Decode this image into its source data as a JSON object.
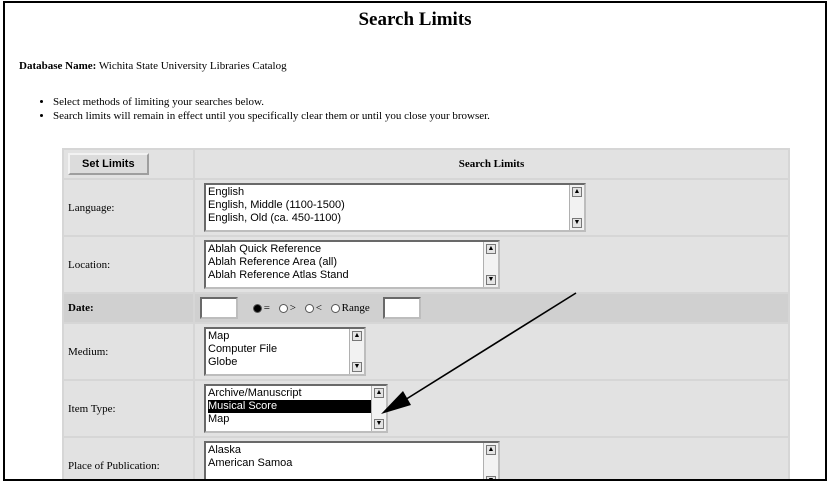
{
  "page": {
    "title": "Search Limits",
    "database_label": "Database Name:",
    "database_name": "Wichita State University Libraries Catalog",
    "bullets": [
      "Select methods of limiting your searches below.",
      "Search limits will remain in effect until you specifically clear them or until you close your browser."
    ]
  },
  "limits_table": {
    "set_limits_button": "Set Limits",
    "header": "Search Limits",
    "rows": {
      "language": {
        "label": "Language:",
        "options": [
          "English",
          "English, Middle (1100-1500)",
          "English, Old (ca. 450-1100)"
        ]
      },
      "location": {
        "label": "Location:",
        "options": [
          "Ablah Quick Reference",
          "Ablah Reference Area (all)",
          "Ablah Reference Atlas Stand"
        ]
      },
      "date": {
        "label": "Date:",
        "radios": [
          "=",
          ">",
          "<",
          "Range"
        ],
        "selected_radio": "="
      },
      "medium": {
        "label": "Medium:",
        "options": [
          "Map",
          "Computer File",
          "Globe"
        ]
      },
      "item_type": {
        "label": "Item Type:",
        "options": [
          "Archive/Manuscript",
          "Musical Score",
          "Map"
        ],
        "selected": "Musical Score"
      },
      "place_of_publication": {
        "label": "Place of Publication:",
        "options": [
          "Alaska",
          "American Samoa"
        ]
      }
    }
  },
  "annotation": {
    "arrow_color": "#000000",
    "icon": "arrow-pointer"
  }
}
